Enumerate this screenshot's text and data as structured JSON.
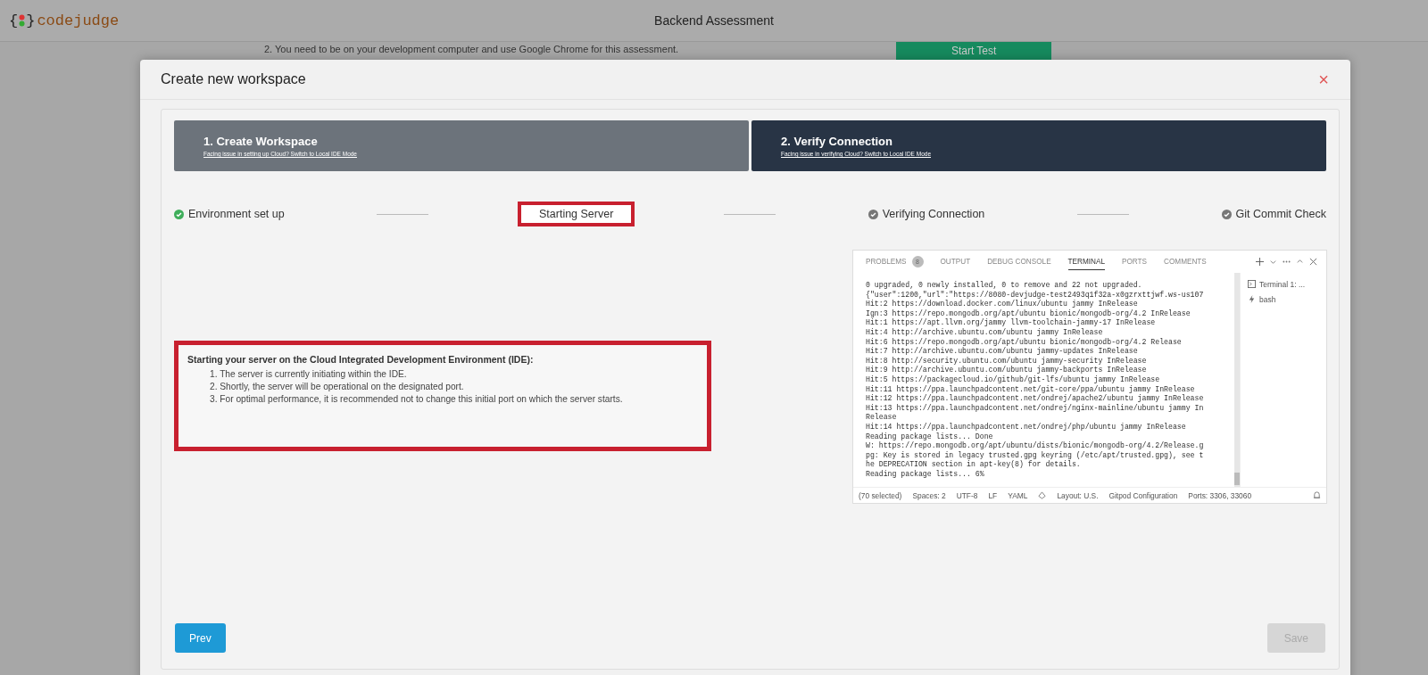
{
  "top_bar": {
    "logo": {
      "open": "{",
      "close": "}",
      "name": "codejudge"
    },
    "title": "Backend Assessment"
  },
  "background_page": {
    "instruction": "2. You need to be on your development computer and use Google Chrome for this assessment.",
    "start_button": "Start Test"
  },
  "modal": {
    "title": "Create new workspace",
    "close": "×",
    "step_tabs": [
      {
        "title": "1. Create Workspace",
        "link": "Facing issue in setting up Cloud? Switch to Local IDE Mode",
        "selected": false
      },
      {
        "title": "2. Verify Connection",
        "link": "Facing issue in verifying Cloud? Switch to Local IDE Mode",
        "selected": true
      }
    ],
    "progress_steps": [
      {
        "label": "Environment set up",
        "checked": true,
        "completed": true,
        "highlighted": false
      },
      {
        "label": "Starting Server",
        "checked": false,
        "highlighted": true
      },
      {
        "label": "Verifying Connection",
        "checked": true,
        "completed": false,
        "highlighted": false
      },
      {
        "label": "Git Commit Check",
        "checked": true,
        "completed": false,
        "highlighted": false
      }
    ],
    "info": {
      "highlighted": true,
      "heading": "Starting your server on the Cloud Integrated Development Environment (IDE):",
      "items": [
        "1. The server is currently initiating within the IDE.",
        "2. Shortly, the server will be operational on the designated port.",
        "3. For optimal performance, it is recommended not to change this initial port on which the server starts."
      ]
    },
    "terminal": {
      "tabs": [
        {
          "label": "PROBLEMS",
          "badge": "8",
          "selected": false
        },
        {
          "label": "OUTPUT",
          "selected": false
        },
        {
          "label": "DEBUG CONSOLE",
          "selected": false
        },
        {
          "label": "TERMINAL",
          "selected": true
        },
        {
          "label": "PORTS",
          "selected": false
        },
        {
          "label": "COMMENTS",
          "selected": false
        }
      ],
      "lines": [
        "0 upgraded, 0 newly installed, 0 to remove and 22 not upgraded.",
        "{\"user\":1200,\"url\":\"https://8080-devjudge-test2493q1f32a-x0gzrxttjwf.ws-us107",
        "Hit:2 https://download.docker.com/linux/ubuntu jammy InRelease",
        "Ign:3 https://repo.mongodb.org/apt/ubuntu bionic/mongodb-org/4.2 InRelease",
        "Hit:1 https://apt.llvm.org/jammy llvm-toolchain-jammy-17 InRelease",
        "Hit:4 http://archive.ubuntu.com/ubuntu jammy InRelease",
        "Hit:6 https://repo.mongodb.org/apt/ubuntu bionic/mongodb-org/4.2 Release",
        "Hit:7 http://archive.ubuntu.com/ubuntu jammy-updates InRelease",
        "Hit:8 http://security.ubuntu.com/ubuntu jammy-security InRelease",
        "Hit:9 http://archive.ubuntu.com/ubuntu jammy-backports InRelease",
        "Hit:5 https://packagecloud.io/github/git-lfs/ubuntu jammy InRelease",
        "Hit:11 https://ppa.launchpadcontent.net/git-core/ppa/ubuntu jammy InRelease",
        "Hit:12 https://ppa.launchpadcontent.net/ondrej/apache2/ubuntu jammy InRelease",
        "Hit:13 https://ppa.launchpadcontent.net/ondrej/nginx-mainline/ubuntu jammy In",
        "Release",
        "Hit:14 https://ppa.launchpadcontent.net/ondrej/php/ubuntu jammy InRelease",
        "Reading package lists... Done",
        "W: https://repo.mongodb.org/apt/ubuntu/dists/bionic/mongodb-org/4.2/Release.g",
        "pg: Key is stored in legacy trusted.gpg keyring (/etc/apt/trusted.gpg), see t",
        "he DEPRECATION section in apt-key(8) for details.",
        "Reading package lists... 6%"
      ],
      "sessions": [
        {
          "label": "Terminal 1: ...",
          "kind": "terminal"
        },
        {
          "label": "bash",
          "kind": "shell"
        }
      ],
      "status_items": [
        "(70 selected)",
        "Spaces: 2",
        "UTF-8",
        "LF",
        "YAML",
        "Layout: U.S.",
        "Gitpod Configuration",
        "Ports: 3306, 33060"
      ]
    },
    "buttons": [
      {
        "label": "Prev",
        "disabled": false
      },
      {
        "label": "Save",
        "disabled": true
      }
    ]
  }
}
